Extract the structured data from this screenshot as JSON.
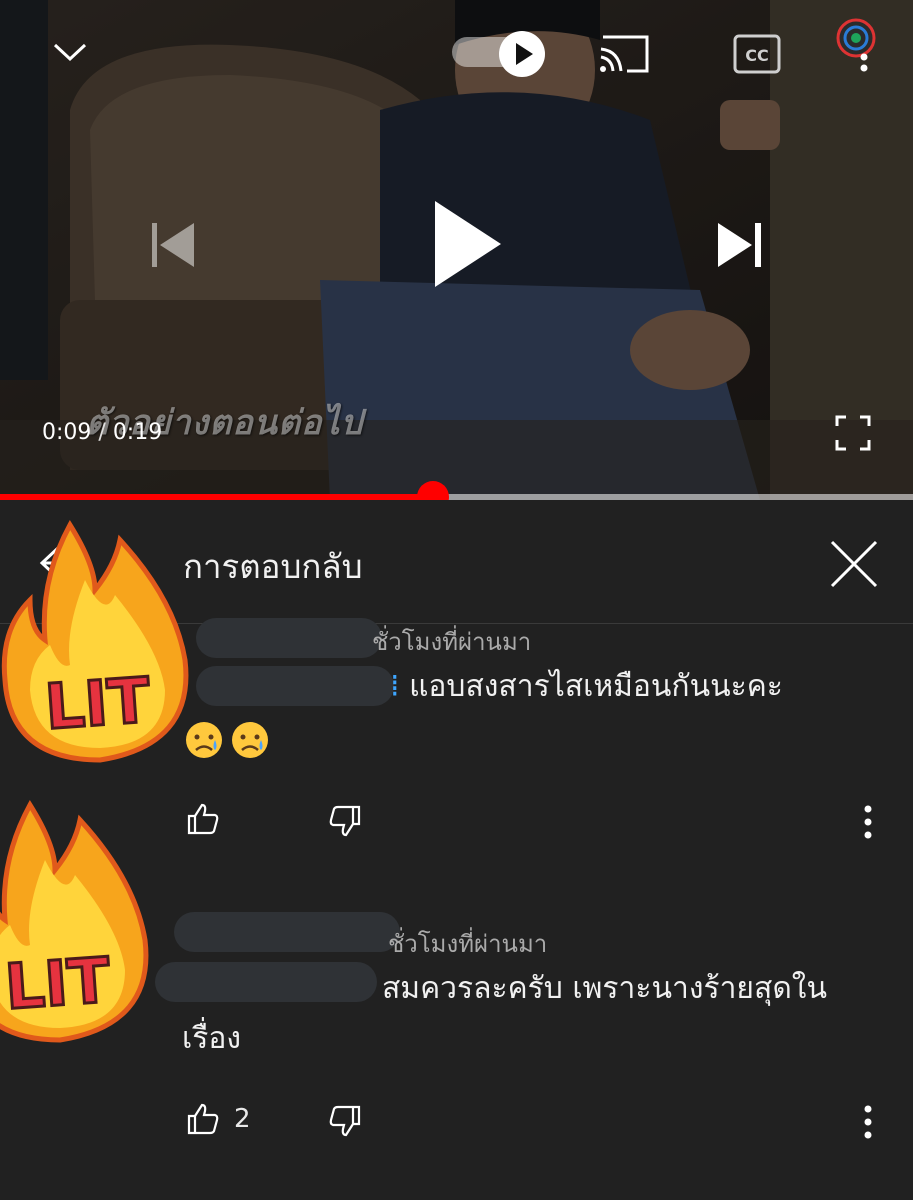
{
  "player": {
    "current_time": "0:09",
    "separator": " / ",
    "duration": "0:19",
    "progress_fraction": 0.474,
    "next_preview_caption": "ตัวอย่างตอนต่อไป",
    "autoplay_on": true
  },
  "panel": {
    "title": "การตอบกลับ"
  },
  "replies": [
    {
      "meta_visible": "ชั่วโมงที่ผ่านมา",
      "text": "แอบสงสารไสเหมือนกันนะคะ",
      "emojis": [
        "😥",
        "😥"
      ],
      "likes": ""
    },
    {
      "meta_visible": "ชั่วโมงที่ผ่านมา",
      "text": "สมควรละครับ เพราะนางร้ายสุดในเรื่อง",
      "emojis": [],
      "likes": "2"
    }
  ],
  "stickers": [
    {
      "label": "LIT"
    },
    {
      "label": "LIT"
    }
  ],
  "colors": {
    "accent_red": "#ff0000",
    "panel_bg": "#212121",
    "mention_blue": "#3ea6ff"
  }
}
